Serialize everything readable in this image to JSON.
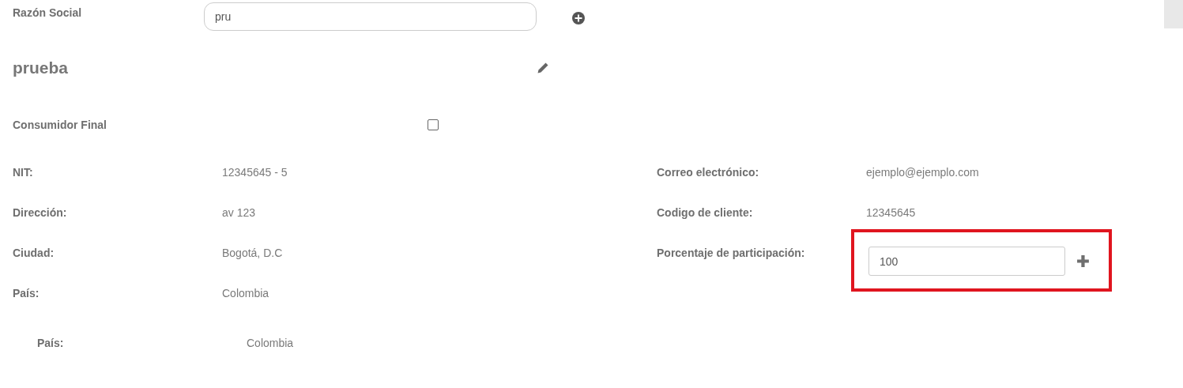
{
  "razon_social": {
    "label": "Razón Social",
    "value": "pru"
  },
  "name": "prueba",
  "consumidor_final": {
    "label": "Consumidor Final",
    "checked": false
  },
  "details_left": [
    {
      "label": "NIT:",
      "value": "12345645 - 5"
    },
    {
      "label": "Dirección:",
      "value": "av 123"
    },
    {
      "label": "Ciudad:",
      "value": "Bogotá, D.C"
    },
    {
      "label": "País:",
      "value": "Colombia"
    }
  ],
  "details_right": [
    {
      "kind": "text",
      "label": "Correo electrónico:",
      "value": "ejemplo@ejemplo.com"
    },
    {
      "kind": "text",
      "label": "Codigo de cliente:",
      "value": "12345645"
    },
    {
      "kind": "input",
      "label": "Porcentaje de participación:",
      "value": "100",
      "highlighted": true
    }
  ],
  "sub_details": [
    {
      "label": "País:",
      "value": "Colombia"
    }
  ]
}
